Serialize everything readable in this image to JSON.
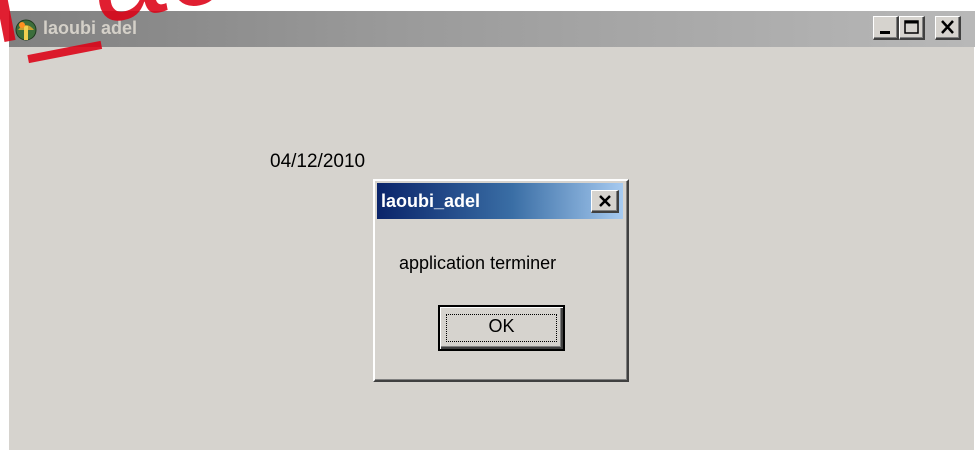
{
  "window": {
    "title": "laoubi adel",
    "icon": "app-icon",
    "controls": {
      "minimize_icon": "minimize-icon",
      "maximize_icon": "maximize-icon",
      "close_icon": "close-icon"
    }
  },
  "main": {
    "date": "04/12/2010"
  },
  "dialog": {
    "title": "laoubi_adel",
    "message": "application terminer",
    "ok_label": "OK",
    "close_icon": "close-icon"
  },
  "watermark": {
    "text": "oi_adel@y"
  },
  "colors": {
    "window_background": "#d6d3ce",
    "inactive_titlebar": "#808080",
    "dialog_titlebar": "#0a246a",
    "watermark": "#dc0014"
  }
}
